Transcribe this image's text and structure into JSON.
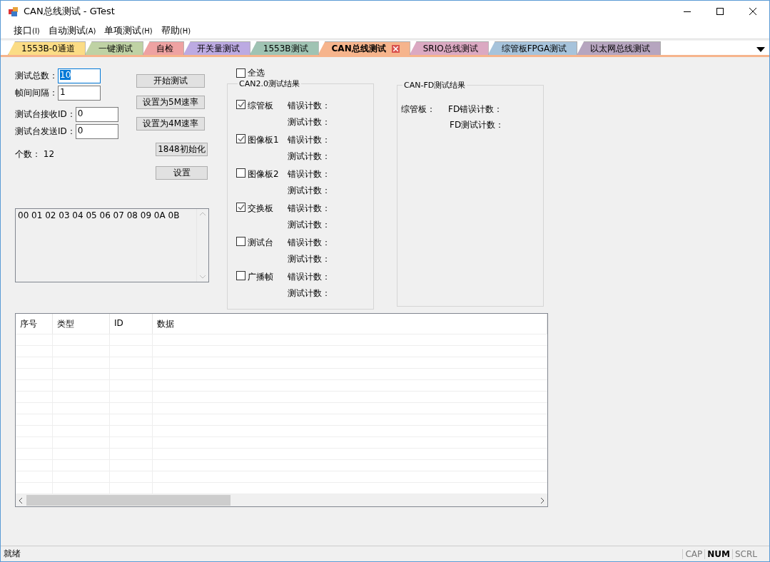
{
  "window": {
    "title": "CAN总线测试 - GTest"
  },
  "menu": [
    {
      "label": "接口",
      "accelerator": "(I)"
    },
    {
      "label": "自动测试",
      "accelerator": "(A)"
    },
    {
      "label": "单项测试",
      "accelerator": "(H)"
    },
    {
      "label": "帮助",
      "accelerator": "(H)"
    }
  ],
  "tabs": [
    {
      "label": "1553B-0通道",
      "color": "#fbdc85",
      "selected": false
    },
    {
      "label": "一键测试",
      "color": "#bfd2a4",
      "selected": false
    },
    {
      "label": "自检",
      "color": "#eea2a2",
      "selected": false
    },
    {
      "label": "开关量测试",
      "color": "#bcaae2",
      "selected": false
    },
    {
      "label": "1553B测试",
      "color": "#9fc3b3",
      "selected": false
    },
    {
      "label": "CAN总线测试",
      "color": "#f6b48c",
      "selected": true
    },
    {
      "label": "SRIO总线测试",
      "color": "#dba9c2",
      "selected": false
    },
    {
      "label": "综管板FPGA测试",
      "color": "#a6c3db",
      "selected": false
    },
    {
      "label": "以太网总线测试",
      "color": "#b6a5bf",
      "selected": false
    }
  ],
  "fields": [
    {
      "label": "测试总数：",
      "value": "10",
      "value_selected": true
    },
    {
      "label": "帧间间隔：",
      "value": "1",
      "value_selected": false
    },
    {
      "label": "测试台接收ID：",
      "value": "0",
      "value_selected": false
    },
    {
      "label": "测试台发送ID：",
      "value": "0",
      "value_selected": false
    }
  ],
  "count": "个数： 12",
  "buttons": [
    "开始测试",
    "设置为5M速率",
    "设置为4M速率",
    "1848初始化",
    "设置"
  ],
  "data_box": {
    "value": "00 01 02 03 04 05 06 07 08 09 0A 0B"
  },
  "select_all": {
    "label": "全选",
    "checked": false
  },
  "can20": {
    "title": "CAN2.0测试结果",
    "boards": [
      {
        "name": "综管板",
        "checked": true,
        "error_label": "错误计数：",
        "test_label": "测试计数："
      },
      {
        "name": "图像板1",
        "checked": true,
        "error_label": "错误计数：",
        "test_label": "测试计数："
      },
      {
        "name": "图像板2",
        "checked": false,
        "error_label": "错误计数：",
        "test_label": "测试计数："
      },
      {
        "name": "交换板",
        "checked": true,
        "error_label": "错误计数：",
        "test_label": "测试计数："
      },
      {
        "name": "测试台",
        "checked": false,
        "error_label": "错误计数：",
        "test_label": "测试计数："
      },
      {
        "name": "广播帧",
        "checked": false,
        "error_label": "错误计数：",
        "test_label": "测试计数："
      }
    ]
  },
  "canfd": {
    "title": "CAN-FD测试结果",
    "board": "综管板：",
    "error_label": "FD错误计数：",
    "test_label": "FD测试计数："
  },
  "table": {
    "columns": [
      "序号",
      "类型",
      "ID",
      "数据"
    ]
  },
  "status_bar": {
    "text": "就绪",
    "indicators": [
      {
        "label": "CAP",
        "on": false
      },
      {
        "label": "NUM",
        "on": true
      },
      {
        "label": "SCRL",
        "on": false
      }
    ]
  }
}
